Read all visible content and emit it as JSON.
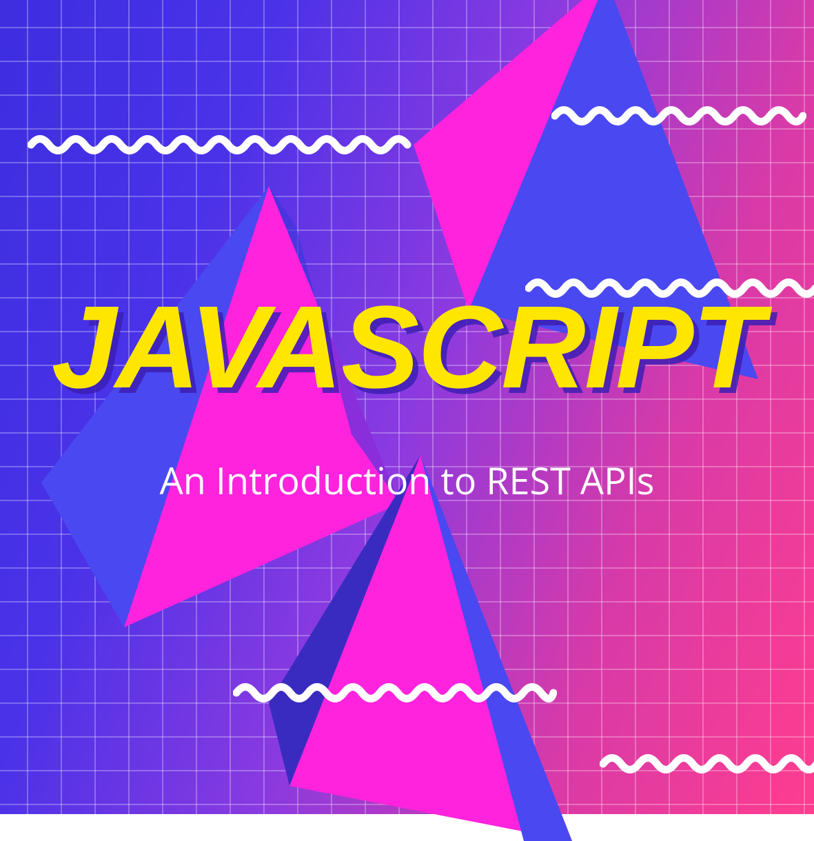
{
  "title": "JAVASCRIPT",
  "subtitle": "An Introduction to REST APIs",
  "colors": {
    "title": "#ffe600",
    "subtitle": "#ffffff",
    "shadow": "#3c1eb4",
    "magenta": "#ff23dd",
    "blue": "#4a48f0",
    "darkblue": "#3a2bc0",
    "squiggle": "#ffffff"
  }
}
